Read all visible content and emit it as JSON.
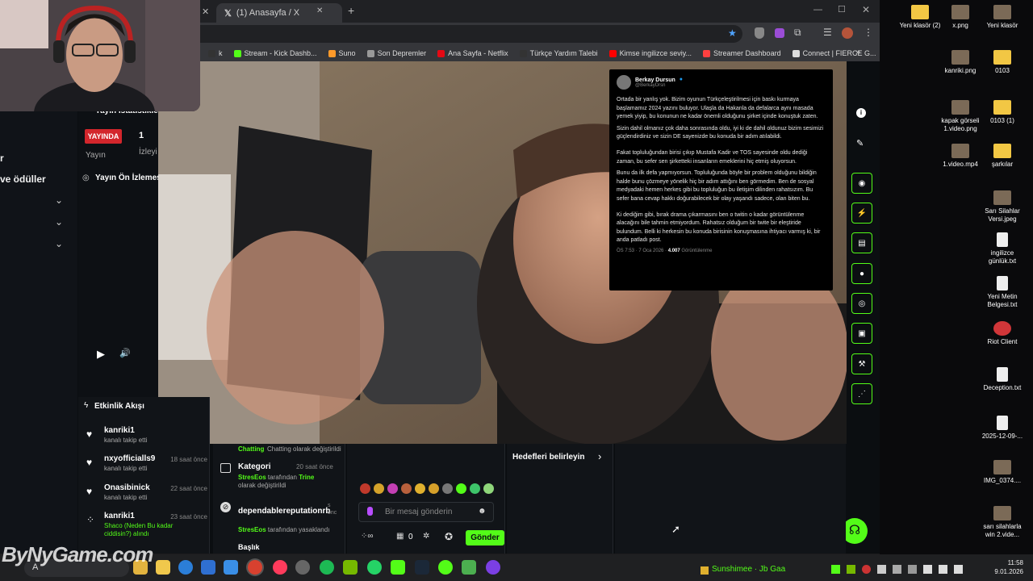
{
  "browser": {
    "tab_title": "(1) Anasayfa / X",
    "new_tab_label": "+",
    "bookmarks": [
      {
        "label": "k",
        "color": "#333"
      },
      {
        "label": "Stream - Kick Dashb...",
        "color": "#53fc18"
      },
      {
        "label": "Suno",
        "color": "#ff9a2a"
      },
      {
        "label": "Son Depremler",
        "color": "#999"
      },
      {
        "label": "Ana Sayfa - Netflix",
        "color": "#e50914"
      },
      {
        "label": "Türkçe Yardım Talebi",
        "color": "#333"
      },
      {
        "label": "Kimse ingilizce seviy...",
        "color": "#ff0000"
      },
      {
        "label": "Streamer Dashboard",
        "color": "#ff4040"
      },
      {
        "label": "Connect | FIERCE G...",
        "color": "#ddd"
      }
    ],
    "more_bookmarks": "»"
  },
  "left": {
    "nav_partial": "r",
    "rewards": "ve ödüller",
    "stream_info": "Yayın İstatistikleri",
    "live_badge": "YAYINDA",
    "stream_label": "Yayın",
    "viewer_count": "1",
    "viewer_label": "İzleyi",
    "preview_title": "Yayın Ön İzlemesi",
    "play": "▶",
    "volume": "🔊"
  },
  "activity": {
    "title": "Etkinlik Akışı",
    "items": [
      {
        "user": "kanriki1",
        "text": "kanalı takip etti",
        "time": ""
      },
      {
        "user": "nxyofficialls9",
        "text": "kanalı takip etti",
        "time": "18 saat önce"
      },
      {
        "user": "Onasibinick",
        "text": "kanalı takip etti",
        "time": "22 saat önce"
      },
      {
        "user": "kanriki1",
        "text": "Shaco (Neden Bu kadar ciddisin?) alındı",
        "time": "23 saat önce"
      }
    ]
  },
  "modlog": {
    "chatting_line": "Chatting olarak değiştirildi",
    "category_title": "Kategori",
    "category_time": "20 saat önce",
    "category_actor": "StresEos",
    "category_mid": "tarafından",
    "category_value": "Trine",
    "category_rest": "olarak değiştirildi",
    "ban_user": "dependablereputationrb",
    "ban_time": "s önc",
    "ban_actor": "StresEos",
    "ban_rest": "tarafından yasaklandı",
    "title_partial": "Başlık"
  },
  "chat": {
    "placeholder": "Bir mesaj gönderin",
    "send": "Gönder",
    "count": "0"
  },
  "goals": {
    "label": "Hedefleri belirleyin"
  },
  "tweet": {
    "name": "Berkay Dursun",
    "handle": "@BerkayDrsn",
    "paragraphs": [
      "Ortada bir yanlış yok. Bizim oyunun Türkçeleştirilmesi için baskı kurmaya başlamamız 2024 yazını buluyor. Ulaşla da Hakanla da defalarca aynı masada yemek yiyip, bu konunun ne kadar önemli olduğunu şirket içinde konuştuk zaten.",
      "Sizin dahil olmanız çok daha sonrasında oldu, iyi ki de dahil oldunuz bizim sesimizi güçlendirdiniz ve sizin DE sayenizde bu konuda bir adım atılabildi.",
      "Fakat topluluğundan birisi çıkıp Mustafa Kadir ve TOS sayesinde oldu dediği zaman, bu sefer sen şirketteki insanların emeklerini hiç etmiş oluyorsun.",
      "Bunu da ilk defa yapmıyorsun. Topluluğunda böyle bir problem olduğunu bildiğin halde bunu çözmeye yönelik hiç bir adım attığını ben görmedim. Ben de sosyal medyadaki hemen herkes gibi bu topluluğun bu iletişim dilinden rahatsızım. Bu sefer bana cevap hakkı doğurabilecek bir olay yaşandı sadece, olan biten bu.",
      "Ki dediğim gibi, bırak drama çıkarmasını ben o twitin o kadar görüntülenme alacağını bile tahmin etmiyordum. Rahatsız olduğum bir twite bir eleştiride bulundum. Belli ki herkesin bu konuda birisinin konuşmasına ihtiyacı varmış ki, bir anda patladı post."
    ],
    "meta": "ÖS 7:53 · 7 Oca 2026 · ",
    "views": "4.007",
    "views_label": " Görüntülenme"
  },
  "taskbar": {
    "search": "A",
    "time": "11:58",
    "date": "9.01.2026",
    "now_playing": "Sunshimee · Jb Gaa"
  },
  "watermark": "ByNyGame.com",
  "desktop": [
    {
      "label": "Yeni klasör (2)",
      "kind": "folder"
    },
    {
      "label": "x.png",
      "kind": "img"
    },
    {
      "label": "Yeni klasör",
      "kind": "img"
    },
    {
      "label": "kanriki.png",
      "kind": "img"
    },
    {
      "label": "0103",
      "kind": "folder"
    },
    {
      "label": "kapak görseli 1.video.png",
      "kind": "img"
    },
    {
      "label": "0103 (1)",
      "kind": "folder"
    },
    {
      "label": "1.video.mp4",
      "kind": "img"
    },
    {
      "label": "şarkılar",
      "kind": "folder"
    },
    {
      "label": "Sarı Silahlar Versi.jpeg",
      "kind": "img"
    },
    {
      "label": "ingilizce günlük.txt",
      "kind": "file"
    },
    {
      "label": "Yeni Metin Belgesi.txt",
      "kind": "file"
    },
    {
      "label": "Riot Client",
      "kind": "riot"
    },
    {
      "label": "Deception.txt",
      "kind": "file"
    },
    {
      "label": "2025-12-09-...",
      "kind": "file"
    },
    {
      "label": "IMG_0374....",
      "kind": "img"
    },
    {
      "label": "sarı silahlarla win 2.vide...",
      "kind": "img"
    }
  ]
}
